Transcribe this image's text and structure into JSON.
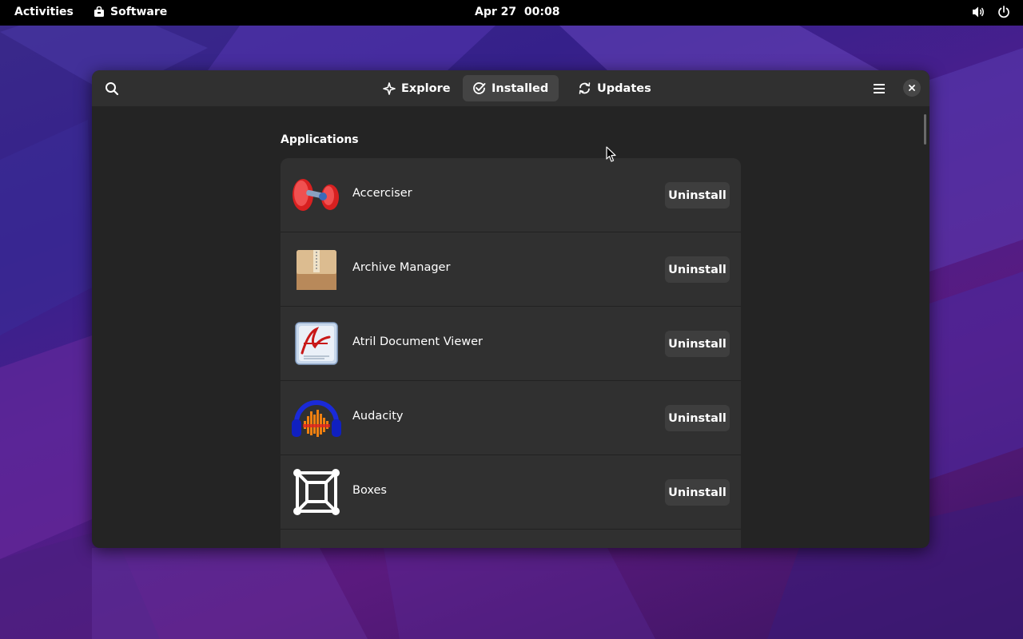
{
  "topbar": {
    "activities": "Activities",
    "app_name": "Software",
    "clock": "Apr 27  00:08",
    "icons": [
      "volume-icon",
      "power-icon"
    ]
  },
  "window": {
    "tabs": [
      {
        "label": "Explore",
        "icon": "sparkle-icon",
        "active": false
      },
      {
        "label": "Installed",
        "icon": "check-circle-icon",
        "active": true
      },
      {
        "label": "Updates",
        "icon": "refresh-icon",
        "active": false
      }
    ],
    "section_title": "Applications",
    "apps": [
      {
        "name": "Accerciser",
        "button": "Uninstall",
        "icon": "accerciser-icon"
      },
      {
        "name": "Archive Manager",
        "button": "Uninstall",
        "icon": "archive-manager-icon"
      },
      {
        "name": "Atril Document Viewer",
        "button": "Uninstall",
        "icon": "atril-icon"
      },
      {
        "name": "Audacity",
        "button": "Uninstall",
        "icon": "audacity-icon"
      },
      {
        "name": "Boxes",
        "button": "Uninstall",
        "icon": "boxes-icon"
      }
    ]
  },
  "colors": {
    "topbar_bg": "#000000",
    "window_bg": "#242424",
    "headerbar_bg": "#303030",
    "list_bg": "#303030",
    "button_bg": "#3e3e3e",
    "active_tab_bg": "#444444"
  }
}
